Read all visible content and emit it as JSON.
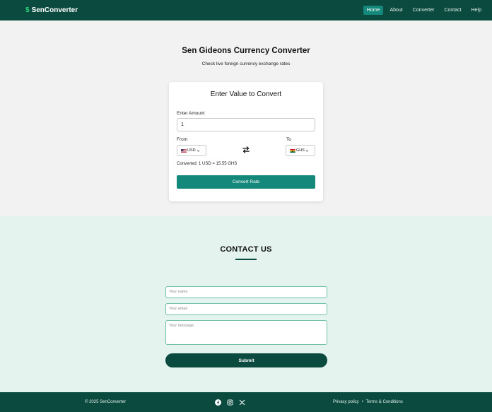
{
  "nav": {
    "brand_icon": "$",
    "brand": "SenConverter",
    "links": [
      "Home",
      "About",
      "Converter",
      "Contact",
      "Help"
    ],
    "active": "Home"
  },
  "hero": {
    "title": "Sen Gideons Currency Converter",
    "subtitle": "Check live foreign currency exchange rates"
  },
  "converter": {
    "title": "Enter Value to Convert",
    "amount_label": "Enter Amount",
    "amount_value": "1",
    "from_label": "From",
    "to_label": "To",
    "from_currency": "USD",
    "to_currency": "GHS",
    "result": "Converted: 1 USD = 15.55 GHS",
    "button": "Convert Rate"
  },
  "contact": {
    "title": "CONTACT US",
    "name_placeholder": "Your name",
    "email_placeholder": "Your email",
    "message_placeholder": "Your message",
    "submit": "Submit"
  },
  "footer": {
    "copyright": "© 2025 SenConverter",
    "socials": [
      "facebook-icon",
      "instagram-icon",
      "x-icon"
    ],
    "privacy": "Privacy policy",
    "separator": "•",
    "terms": "Terms & Conditions"
  },
  "colors": {
    "primary_dark": "#0b4a3f",
    "accent": "#14887a",
    "brand_icon": "#2bd17a",
    "contact_bg": "#e4f3ee"
  }
}
